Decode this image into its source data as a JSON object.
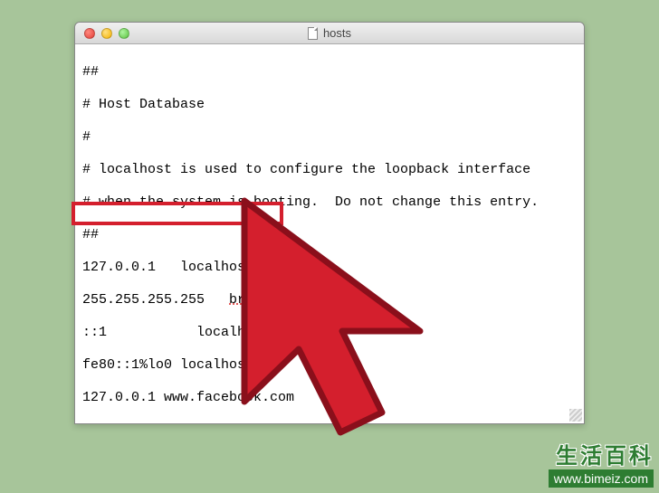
{
  "window": {
    "title": "hosts"
  },
  "editor": {
    "lines": [
      "##",
      "# Host Database",
      "#",
      "# localhost is used to configure the loopback interface",
      "# when the system is booting.  Do not change this entry.",
      "##",
      "127.0.0.1   localhost",
      "255.255.255.255   ",
      "::1           localhost",
      "fe80::1%lo0 localhost",
      "127.0.0.1 www.facebook.com"
    ],
    "broadcast_token": "broadcasthost",
    "highlighted_index": 10
  },
  "watermark": {
    "line1": "生活百科",
    "line2": "www.bimeiz.com"
  },
  "colors": {
    "background": "#a7c59a",
    "highlight": "#d41f2d",
    "cursor_fill": "#d41f2d",
    "cursor_stroke": "#8a0f1b"
  }
}
